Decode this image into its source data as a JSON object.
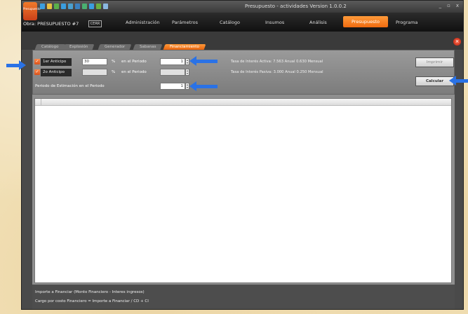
{
  "app": {
    "logo_text": "Presupuesto",
    "window_title": "Presupuesto - actividades Version 1.0.0.2",
    "window_controls": [
      "_",
      "▫",
      "x"
    ]
  },
  "menubar": {
    "document_name": "Obra: PRESUPUESTO #7",
    "document_button": "CERR",
    "items": [
      "Administración",
      "Parámetros",
      "Catálogo",
      "Insumos",
      "Análisis",
      "Presupuesto",
      "Programa"
    ],
    "active": "Presupuesto"
  },
  "tabs": {
    "items": [
      "Catálogo",
      "Explosión",
      "Generador",
      "Sabanas",
      "Financiamiento"
    ],
    "active": "Financiamiento"
  },
  "financiamiento": {
    "anticipo1": {
      "label": "1er Anticipo",
      "value": "30",
      "percent": "%",
      "en_label": "en el Periodo",
      "periodo": "1"
    },
    "anticipo2": {
      "label": "2o Anticipo",
      "value": "",
      "percent": "%",
      "en_label": "en el Periodo",
      "periodo": ""
    },
    "estimacion": {
      "label": "Periodo de Estimación en el Periodo",
      "value": "1"
    },
    "tasa_activa": "Tasa de Interés Activa: 7.563 Anual 0.630 Mensual",
    "tasa_pasiva": "Tasa de Interés Pasiva: 3.000 Anual 0.250 Mensual",
    "buttons": {
      "imprimir": "Imprimir",
      "calcular": "Calcular"
    }
  },
  "footer": {
    "line1": "Importe a Financiar (Monto Financiero - Interes ingresos)",
    "line2": "Cargo por costo Financiero = Importe a Financiar / CD + CI"
  },
  "colors": {
    "accent": "#f07a20",
    "arrow": "#2a72e6",
    "background": "#f1dfb4"
  }
}
